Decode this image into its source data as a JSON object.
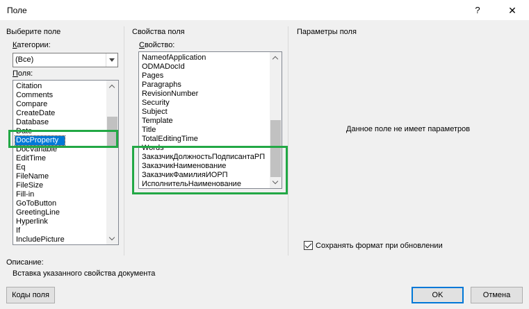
{
  "window": {
    "title": "Поле",
    "help_glyph": "?",
    "close_glyph": "✕"
  },
  "left": {
    "section_title": "Выберите поле",
    "categories_label": "Категории:",
    "categories_value": "(Все)",
    "fields_label": "Поля:",
    "fields": [
      "Citation",
      "Comments",
      "Compare",
      "CreateDate",
      "Database",
      "Date",
      "DocProperty",
      "DocVariable",
      "EditTime",
      "Eq",
      "FileName",
      "FileSize",
      "Fill-in",
      "GoToButton",
      "GreetingLine",
      "Hyperlink",
      "If",
      "IncludePicture"
    ],
    "selected_field": "DocProperty"
  },
  "middle": {
    "section_title": "Свойства поля",
    "property_label": "Свойство:",
    "properties": [
      "NameofApplication",
      "ODMADocId",
      "Pages",
      "Paragraphs",
      "RevisionNumber",
      "Security",
      "Subject",
      "Template",
      "Title",
      "TotalEditingTime",
      "Words",
      "ЗаказчикДолжностьПодписантаРП",
      "ЗаказчикНаименование",
      "ЗаказчикФамилияИОРП",
      "ИсполнительНаименование"
    ]
  },
  "right": {
    "section_title": "Параметры поля",
    "no_params_text": "Данное поле не имеет параметров",
    "preserve_format_label": "Сохранять формат при обновлении",
    "preserve_format_checked": true
  },
  "description": {
    "label": "Описание:",
    "text": "Вставка указанного свойства документа"
  },
  "buttons": {
    "field_codes": "Коды поля",
    "ok": "OK",
    "cancel": "Отмена"
  },
  "colors": {
    "highlight_box": "#22a845",
    "selection": "#0078d7"
  }
}
